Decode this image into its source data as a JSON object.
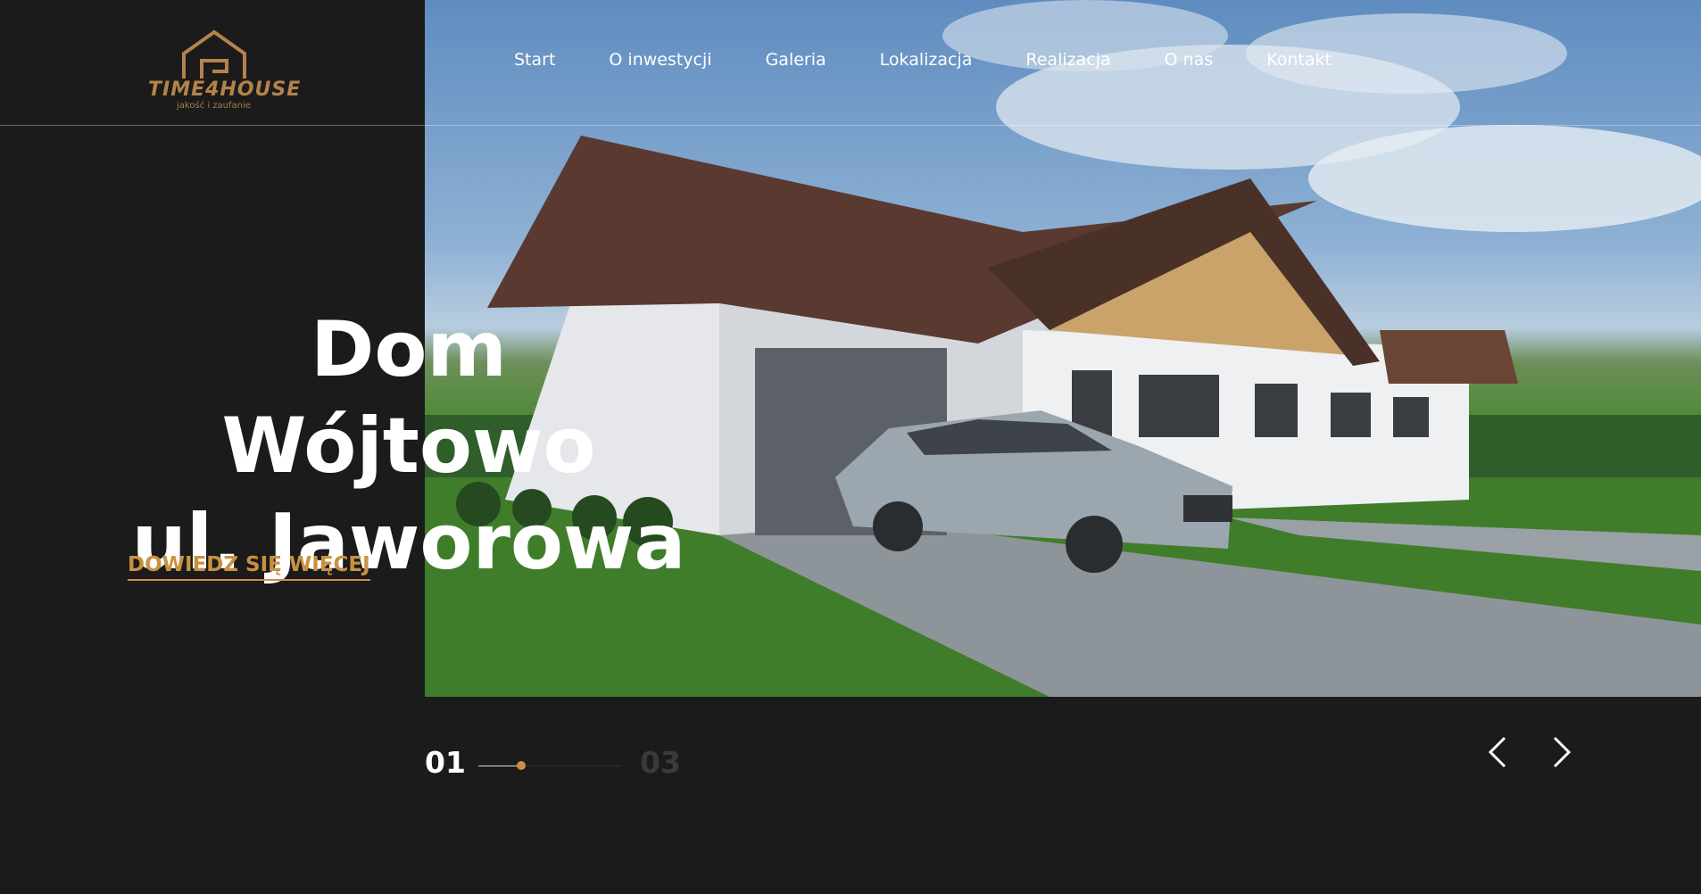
{
  "brand": {
    "name": "TIME4HOUSE",
    "tagline": "jakość i zaufanie",
    "accent": "#c9913f"
  },
  "nav": {
    "items": [
      {
        "label": "Start"
      },
      {
        "label": "O inwestycji"
      },
      {
        "label": "Galeria"
      },
      {
        "label": "Lokalizacja"
      },
      {
        "label": "Realizacja"
      },
      {
        "label": "O nas"
      },
      {
        "label": "Kontakt"
      }
    ]
  },
  "hero": {
    "title_line1": "Dom Wójtowo",
    "title_line2": "ul. Jaworowa",
    "cta_label": "DOWIEDZ SIĘ WIĘCEJ"
  },
  "slider": {
    "current": "01",
    "total": "03",
    "progress": 0.3,
    "prev_icon": "chevron-left-icon",
    "next_icon": "chevron-right-icon"
  }
}
